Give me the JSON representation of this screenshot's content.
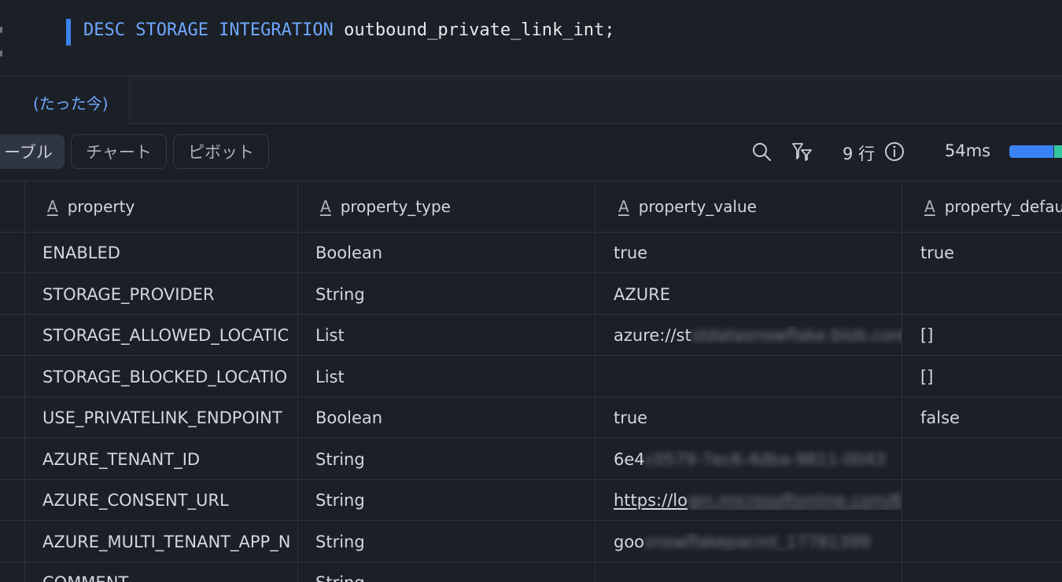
{
  "editor": {
    "sql_keywords": "DESC STORAGE INTEGRATION",
    "sql_object": "outbound_private_link_int;"
  },
  "result_tab": {
    "label": "(たった今)"
  },
  "toolbar": {
    "view_table": "ーブル",
    "view_chart": "チャート",
    "view_pivot": "ピボット",
    "row_count": "9 行",
    "duration": "54ms",
    "icons": {
      "search": "search-icon",
      "filter": "filter-icon",
      "info": "info-icon"
    }
  },
  "table": {
    "columns": [
      "property",
      "property_type",
      "property_value",
      "property_defau"
    ],
    "rows": [
      {
        "property": "ENABLED",
        "type": "Boolean",
        "value": "true",
        "value_hidden": "",
        "default": "true"
      },
      {
        "property": "STORAGE_PROVIDER",
        "type": "String",
        "value": "AZURE",
        "value_hidden": "",
        "default": ""
      },
      {
        "property": "STORAGE_ALLOWED_LOCATIC",
        "type": "List",
        "value": "azure://st",
        "value_hidden": "stdatasnowflake.blob.core",
        "default": "[]"
      },
      {
        "property": "STORAGE_BLOCKED_LOCATIO",
        "type": "List",
        "value": "",
        "value_hidden": "",
        "default": "[]"
      },
      {
        "property": "USE_PRIVATELINK_ENDPOINT",
        "type": "Boolean",
        "value": "true",
        "value_hidden": "",
        "default": "false"
      },
      {
        "property": "AZURE_TENANT_ID",
        "type": "String",
        "value": "6e4",
        "value_hidden": "c0579-7ec6-4dba-9811-0043",
        "default": ""
      },
      {
        "property": "AZURE_CONSENT_URL",
        "type": "String",
        "value": "https://lo",
        "value_hidden": "gin.microsoftonline.com/6",
        "default": ""
      },
      {
        "property": "AZURE_MULTI_TENANT_APP_N",
        "type": "String",
        "value": "goo",
        "value_hidden": "snowflakepacint_17781399",
        "default": ""
      },
      {
        "property": "COMMENT",
        "type": "String",
        "value": "",
        "value_hidden": "",
        "default": ""
      }
    ]
  }
}
